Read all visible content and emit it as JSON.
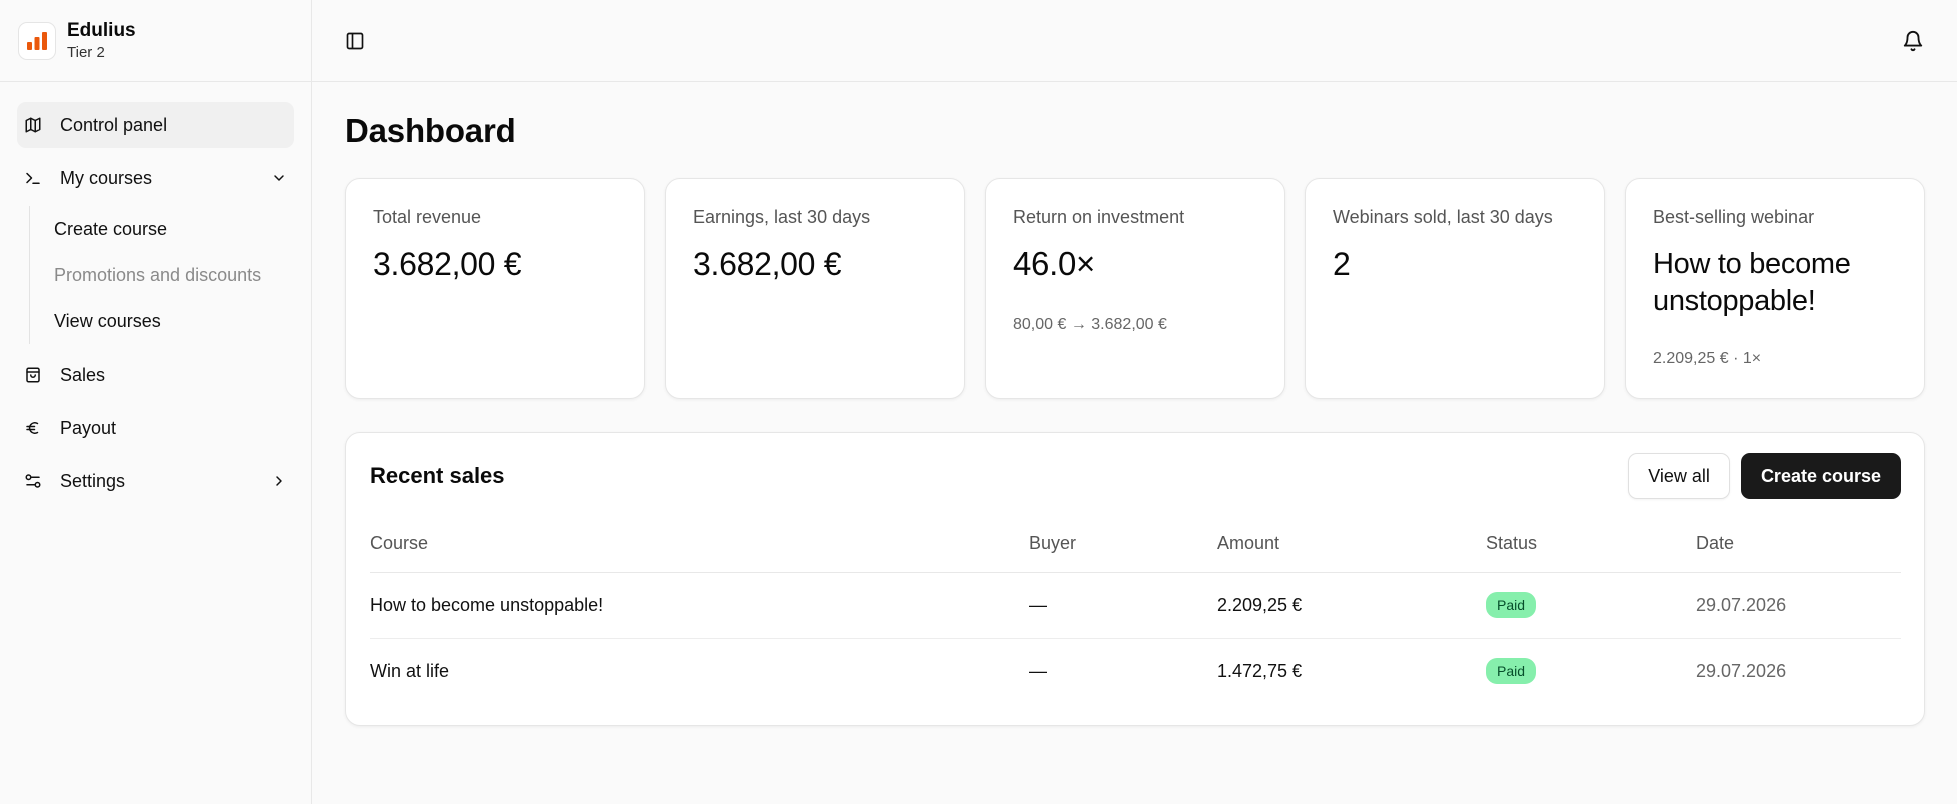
{
  "brand": {
    "name": "Edulius",
    "tier": "Tier 2",
    "accent_color": "#ea580c"
  },
  "sidebar": {
    "items": [
      {
        "label": "Control panel",
        "icon": "map-icon",
        "active": true
      },
      {
        "label": "My courses",
        "icon": "terminal-icon",
        "expanded": true,
        "children": [
          {
            "label": "Create course"
          },
          {
            "label": "Promotions and discounts",
            "muted": true
          },
          {
            "label": "View courses"
          }
        ]
      },
      {
        "label": "Sales",
        "icon": "shopping-bag-icon"
      },
      {
        "label": "Payout",
        "icon": "euro-icon"
      },
      {
        "label": "Settings",
        "icon": "sliders-icon"
      }
    ]
  },
  "topbar": {
    "toggle_icon": "sidebar-toggle-icon",
    "notification_icon": "bell-icon"
  },
  "page": {
    "title": "Dashboard"
  },
  "cards": [
    {
      "label": "Total revenue",
      "value": "3.682,00 €"
    },
    {
      "label": "Earnings, last 30 days",
      "value": "3.682,00 €"
    },
    {
      "label": "Return on investment",
      "value": "46.0×",
      "sub": "80,00 € → 3.682,00 €"
    },
    {
      "label": "Webinars sold, last 30 days",
      "value": "2"
    },
    {
      "label": "Best-selling webinar",
      "value": "How to become unstoppable!",
      "sub": "2.209,25 € · 1×"
    }
  ],
  "recent_sales": {
    "title": "Recent sales",
    "view_all_label": "View all",
    "create_course_label": "Create course",
    "columns": [
      "Course",
      "Buyer",
      "Amount",
      "Status",
      "Date"
    ],
    "rows": [
      {
        "course": "How to become unstoppable!",
        "buyer": "—",
        "amount": "2.209,25 €",
        "status": "Paid",
        "date": "29.07.2026"
      },
      {
        "course": "Win at life",
        "buyer": "—",
        "amount": "1.472,75 €",
        "status": "Paid",
        "date": "29.07.2026"
      }
    ],
    "status_color": "#86efac"
  }
}
